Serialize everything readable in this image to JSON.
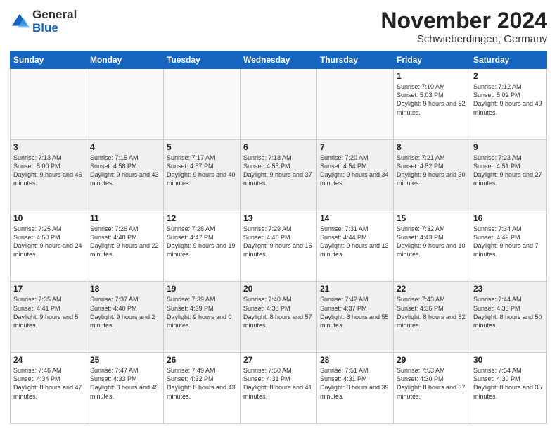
{
  "logo": {
    "general": "General",
    "blue": "Blue"
  },
  "header": {
    "month": "November 2024",
    "location": "Schwieberdingen, Germany"
  },
  "days_of_week": [
    "Sunday",
    "Monday",
    "Tuesday",
    "Wednesday",
    "Thursday",
    "Friday",
    "Saturday"
  ],
  "weeks": [
    [
      {
        "day": "",
        "info": ""
      },
      {
        "day": "",
        "info": ""
      },
      {
        "day": "",
        "info": ""
      },
      {
        "day": "",
        "info": ""
      },
      {
        "day": "",
        "info": ""
      },
      {
        "day": "1",
        "info": "Sunrise: 7:10 AM\nSunset: 5:03 PM\nDaylight: 9 hours and 52 minutes."
      },
      {
        "day": "2",
        "info": "Sunrise: 7:12 AM\nSunset: 5:02 PM\nDaylight: 9 hours and 49 minutes."
      }
    ],
    [
      {
        "day": "3",
        "info": "Sunrise: 7:13 AM\nSunset: 5:00 PM\nDaylight: 9 hours and 46 minutes."
      },
      {
        "day": "4",
        "info": "Sunrise: 7:15 AM\nSunset: 4:58 PM\nDaylight: 9 hours and 43 minutes."
      },
      {
        "day": "5",
        "info": "Sunrise: 7:17 AM\nSunset: 4:57 PM\nDaylight: 9 hours and 40 minutes."
      },
      {
        "day": "6",
        "info": "Sunrise: 7:18 AM\nSunset: 4:55 PM\nDaylight: 9 hours and 37 minutes."
      },
      {
        "day": "7",
        "info": "Sunrise: 7:20 AM\nSunset: 4:54 PM\nDaylight: 9 hours and 34 minutes."
      },
      {
        "day": "8",
        "info": "Sunrise: 7:21 AM\nSunset: 4:52 PM\nDaylight: 9 hours and 30 minutes."
      },
      {
        "day": "9",
        "info": "Sunrise: 7:23 AM\nSunset: 4:51 PM\nDaylight: 9 hours and 27 minutes."
      }
    ],
    [
      {
        "day": "10",
        "info": "Sunrise: 7:25 AM\nSunset: 4:50 PM\nDaylight: 9 hours and 24 minutes."
      },
      {
        "day": "11",
        "info": "Sunrise: 7:26 AM\nSunset: 4:48 PM\nDaylight: 9 hours and 22 minutes."
      },
      {
        "day": "12",
        "info": "Sunrise: 7:28 AM\nSunset: 4:47 PM\nDaylight: 9 hours and 19 minutes."
      },
      {
        "day": "13",
        "info": "Sunrise: 7:29 AM\nSunset: 4:46 PM\nDaylight: 9 hours and 16 minutes."
      },
      {
        "day": "14",
        "info": "Sunrise: 7:31 AM\nSunset: 4:44 PM\nDaylight: 9 hours and 13 minutes."
      },
      {
        "day": "15",
        "info": "Sunrise: 7:32 AM\nSunset: 4:43 PM\nDaylight: 9 hours and 10 minutes."
      },
      {
        "day": "16",
        "info": "Sunrise: 7:34 AM\nSunset: 4:42 PM\nDaylight: 9 hours and 7 minutes."
      }
    ],
    [
      {
        "day": "17",
        "info": "Sunrise: 7:35 AM\nSunset: 4:41 PM\nDaylight: 9 hours and 5 minutes."
      },
      {
        "day": "18",
        "info": "Sunrise: 7:37 AM\nSunset: 4:40 PM\nDaylight: 9 hours and 2 minutes."
      },
      {
        "day": "19",
        "info": "Sunrise: 7:39 AM\nSunset: 4:39 PM\nDaylight: 9 hours and 0 minutes."
      },
      {
        "day": "20",
        "info": "Sunrise: 7:40 AM\nSunset: 4:38 PM\nDaylight: 8 hours and 57 minutes."
      },
      {
        "day": "21",
        "info": "Sunrise: 7:42 AM\nSunset: 4:37 PM\nDaylight: 8 hours and 55 minutes."
      },
      {
        "day": "22",
        "info": "Sunrise: 7:43 AM\nSunset: 4:36 PM\nDaylight: 8 hours and 52 minutes."
      },
      {
        "day": "23",
        "info": "Sunrise: 7:44 AM\nSunset: 4:35 PM\nDaylight: 8 hours and 50 minutes."
      }
    ],
    [
      {
        "day": "24",
        "info": "Sunrise: 7:46 AM\nSunset: 4:34 PM\nDaylight: 8 hours and 47 minutes."
      },
      {
        "day": "25",
        "info": "Sunrise: 7:47 AM\nSunset: 4:33 PM\nDaylight: 8 hours and 45 minutes."
      },
      {
        "day": "26",
        "info": "Sunrise: 7:49 AM\nSunset: 4:32 PM\nDaylight: 8 hours and 43 minutes."
      },
      {
        "day": "27",
        "info": "Sunrise: 7:50 AM\nSunset: 4:31 PM\nDaylight: 8 hours and 41 minutes."
      },
      {
        "day": "28",
        "info": "Sunrise: 7:51 AM\nSunset: 4:31 PM\nDaylight: 8 hours and 39 minutes."
      },
      {
        "day": "29",
        "info": "Sunrise: 7:53 AM\nSunset: 4:30 PM\nDaylight: 8 hours and 37 minutes."
      },
      {
        "day": "30",
        "info": "Sunrise: 7:54 AM\nSunset: 4:30 PM\nDaylight: 8 hours and 35 minutes."
      }
    ]
  ]
}
